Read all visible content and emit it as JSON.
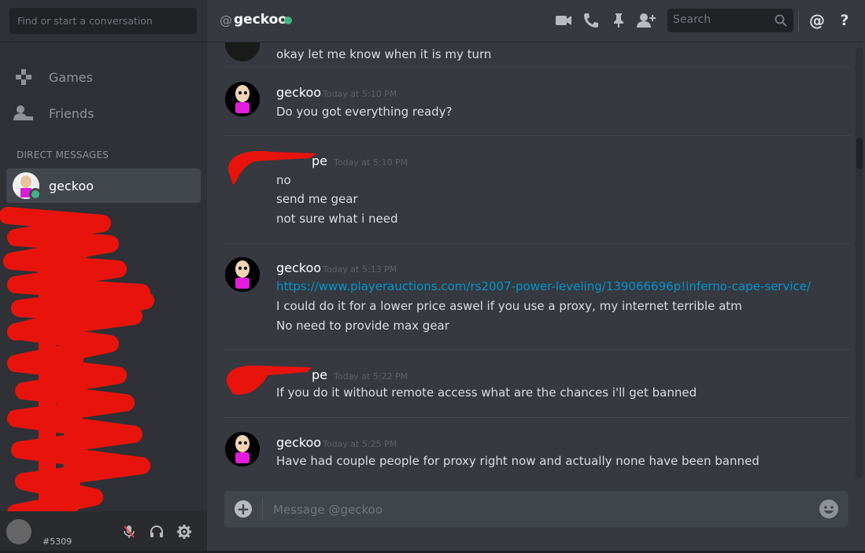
{
  "sidebar": {
    "search_placeholder": "Find or start a conversation",
    "nav": [
      {
        "label": "Games",
        "icon": "gamepad-icon"
      },
      {
        "label": "Friends",
        "icon": "friends-icon"
      }
    ],
    "dm_header": "DIRECT MESSAGES",
    "dm_items": [
      {
        "name": "geckoo",
        "status": "online"
      }
    ],
    "user_panel": {
      "tag": "#5309"
    }
  },
  "header": {
    "at": "@",
    "name": "geckoo",
    "search_placeholder": "Search"
  },
  "messages": [
    {
      "author": "",
      "time": "",
      "lines": [
        "okay let me know when it is my turn"
      ]
    },
    {
      "author": "geckoo",
      "time": "Today at 5:10 PM",
      "lines": [
        "Do you got everything ready?"
      ]
    },
    {
      "author": "pe",
      "time": "Today at 5:10 PM",
      "lines": [
        "no",
        "send me gear",
        "not sure what i need"
      ]
    },
    {
      "author": "geckoo",
      "time": "Today at 5:13 PM",
      "link": "https://www.playerauctions.com/rs2007-power-leveling/139066696p!inferno-cape-service/",
      "lines": [
        "I could do it for a lower price aswel if you use a proxy, my internet terrible atm",
        "No need to provide max gear"
      ]
    },
    {
      "author": "pe",
      "time": "Today at 5:22 PM",
      "lines": [
        "If you do it without remote access what are the chances i'll get banned"
      ]
    },
    {
      "author": "geckoo",
      "time": "Today at 5:25 PM",
      "lines": [
        "Have had couple people for proxy right now and actually none have been banned"
      ]
    }
  ],
  "composer": {
    "placeholder": "Message @geckoo",
    "add": "+"
  },
  "colors": {
    "online": "#43b581",
    "link": "#0096cf",
    "scribble": "#e8140c"
  }
}
